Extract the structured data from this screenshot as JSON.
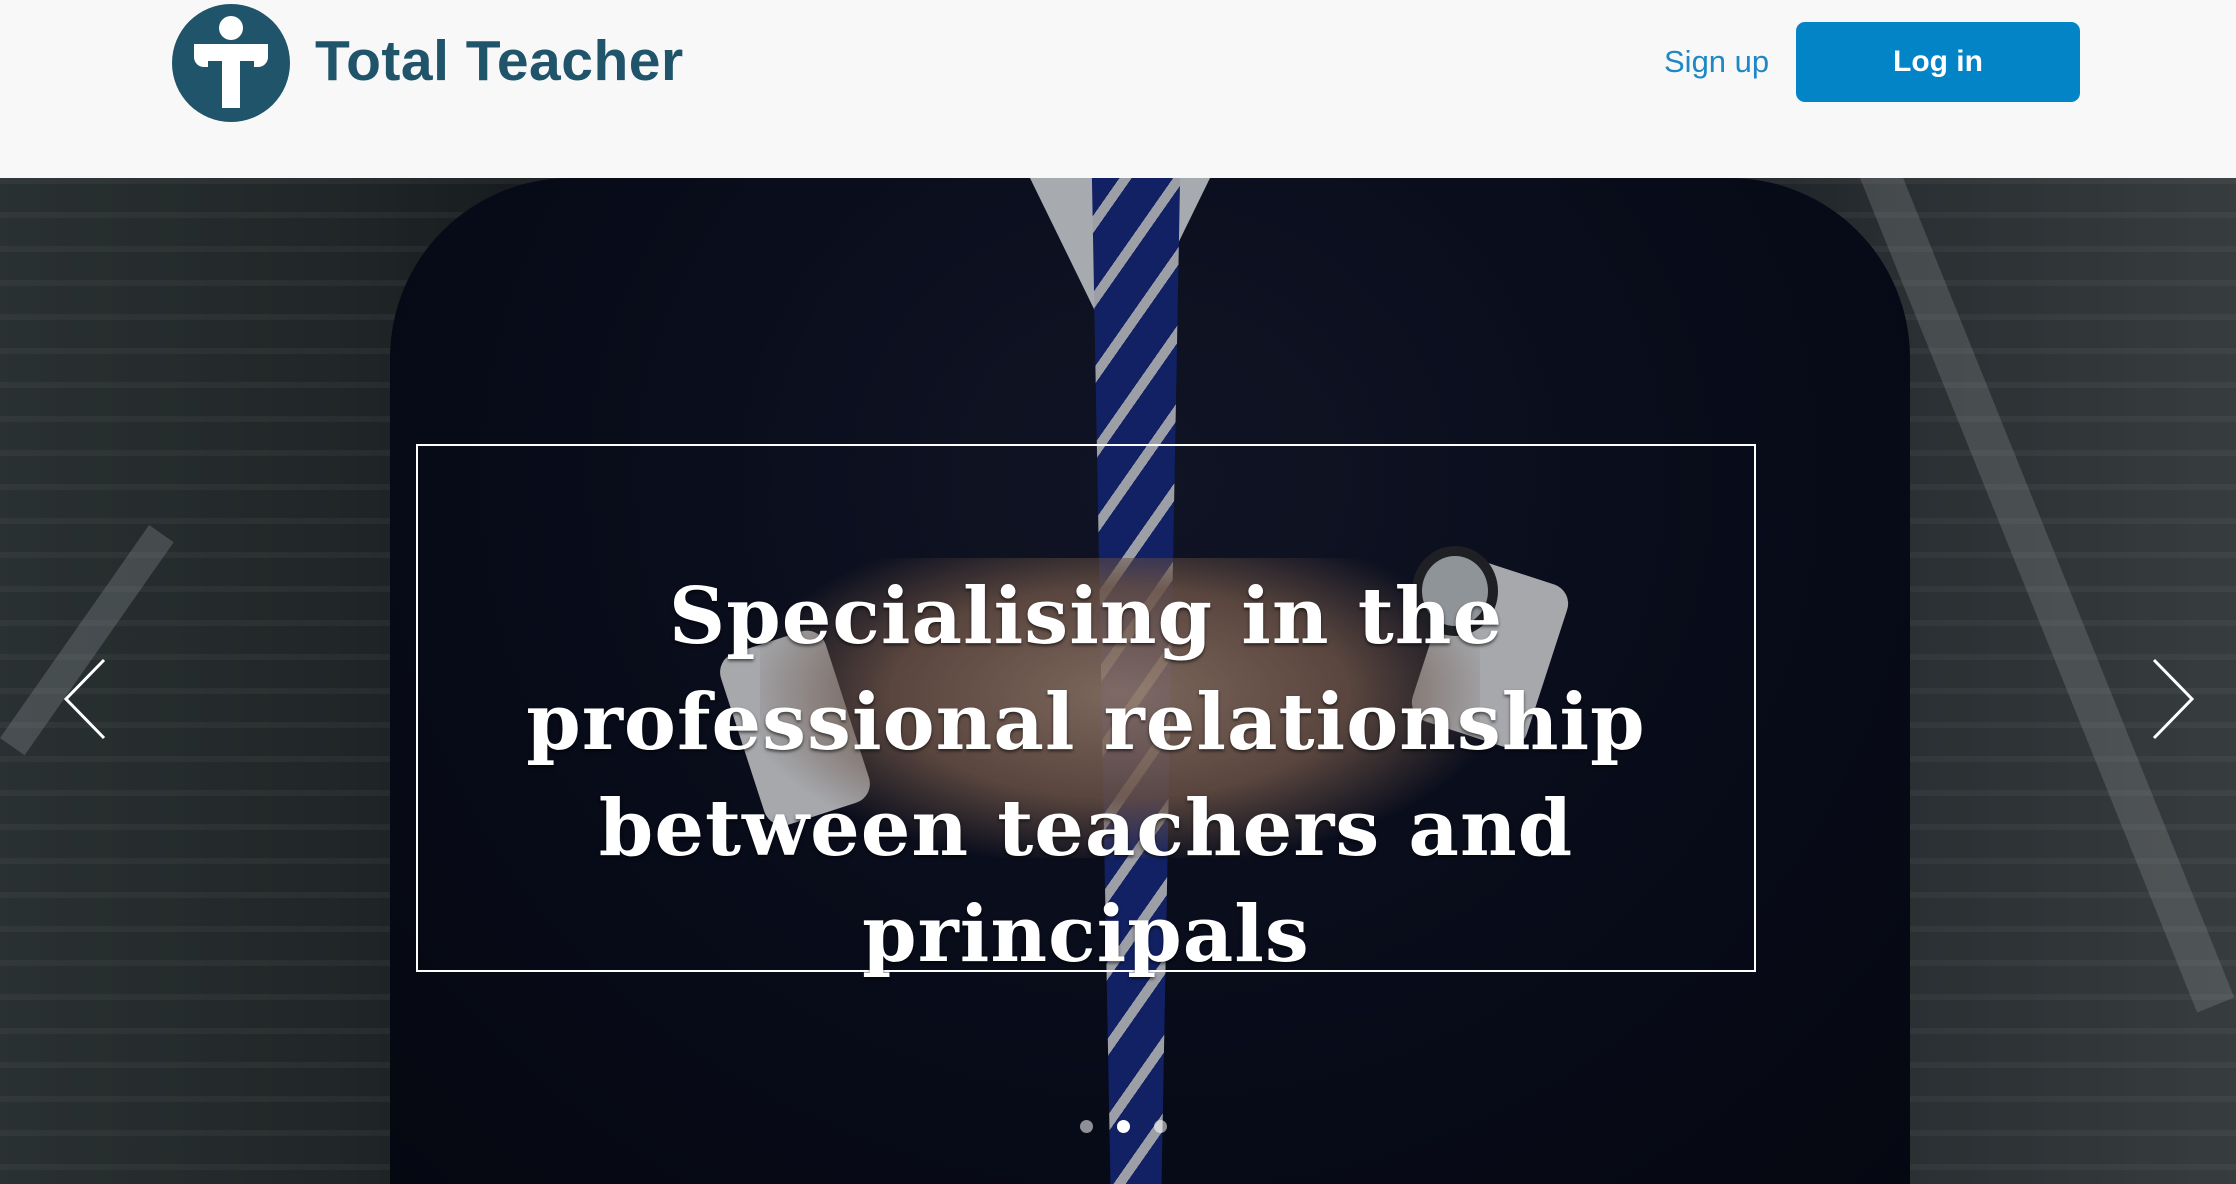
{
  "header": {
    "brand_name": "Total Teacher",
    "logo_icon": "total-teacher-logo-icon",
    "signup_label": "Sign up",
    "login_label": "Log in",
    "brand_color": "#1f546b",
    "accent_color": "#0284c7"
  },
  "hero": {
    "headline": "Specialising in the professional relationship between teachers and principals",
    "prev_icon": "chevron-left-icon",
    "next_icon": "chevron-right-icon",
    "slides": [
      {
        "active": false
      },
      {
        "active": true
      },
      {
        "active": false
      }
    ]
  }
}
